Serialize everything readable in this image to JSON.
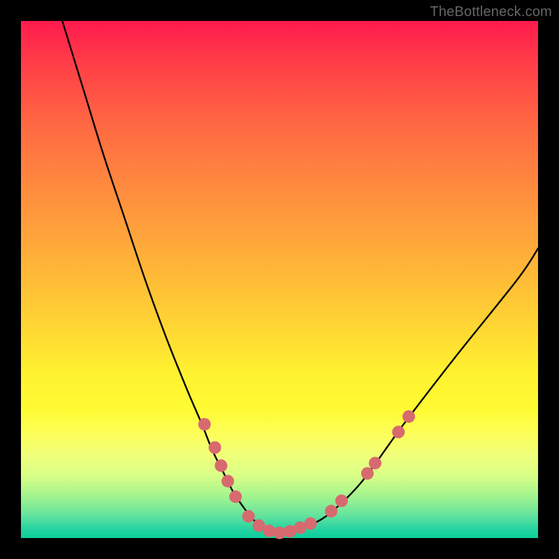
{
  "attribution": "TheBottleneck.com",
  "chart_data": {
    "type": "line",
    "title": "",
    "xlabel": "",
    "ylabel": "",
    "xlim": [
      0,
      100
    ],
    "ylim": [
      0,
      100
    ],
    "grid": false,
    "legend": false,
    "series": [
      {
        "name": "curve",
        "color": "#000000",
        "x": [
          8,
          12,
          16,
          20,
          24,
          28,
          32,
          35,
          37,
          39,
          41,
          43,
          45,
          47,
          49,
          51,
          53,
          56,
          60,
          66,
          74,
          84,
          96,
          100
        ],
        "y": [
          100,
          87,
          74,
          62,
          50,
          39,
          29,
          22,
          17,
          13,
          9,
          6,
          3.5,
          2,
          1.3,
          1,
          1.3,
          2.5,
          5,
          11,
          22,
          35,
          50,
          56
        ]
      }
    ],
    "markers": [
      {
        "name": "curve-dots",
        "color": "#d76a6f",
        "radius": 9,
        "points": [
          {
            "x": 35.5,
            "y": 22
          },
          {
            "x": 37.5,
            "y": 17.5
          },
          {
            "x": 38.7,
            "y": 14
          },
          {
            "x": 40.0,
            "y": 11
          },
          {
            "x": 41.5,
            "y": 8
          },
          {
            "x": 44.0,
            "y": 4.2
          },
          {
            "x": 46.0,
            "y": 2.4
          },
          {
            "x": 48.0,
            "y": 1.4
          },
          {
            "x": 50.0,
            "y": 1.0
          },
          {
            "x": 52.0,
            "y": 1.3
          },
          {
            "x": 54.0,
            "y": 2.0
          },
          {
            "x": 56.0,
            "y": 2.8
          },
          {
            "x": 60.0,
            "y": 5.2
          },
          {
            "x": 62.0,
            "y": 7.2
          },
          {
            "x": 67.0,
            "y": 12.5
          },
          {
            "x": 68.5,
            "y": 14.5
          },
          {
            "x": 73.0,
            "y": 20.5
          },
          {
            "x": 75.0,
            "y": 23.5
          }
        ]
      }
    ]
  }
}
